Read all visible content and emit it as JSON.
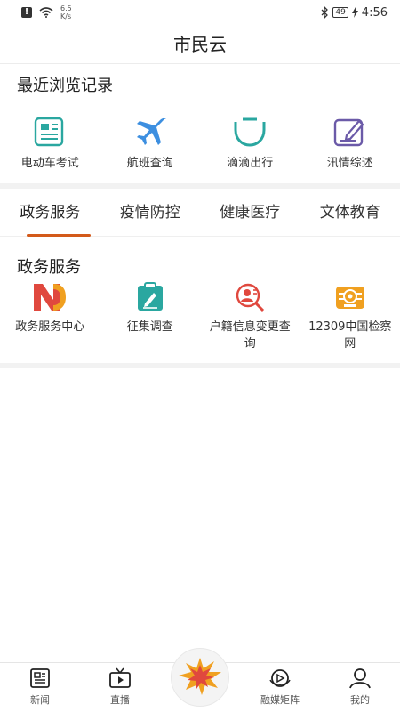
{
  "status_bar": {
    "net_speed_value": "6.5",
    "net_speed_unit": "K/s",
    "battery": "49",
    "time": "4:56"
  },
  "header": {
    "title": "市民云"
  },
  "recent": {
    "title": "最近浏览记录",
    "items": [
      {
        "label": "电动车考试",
        "icon": "document-list-icon"
      },
      {
        "label": "航班查询",
        "icon": "airplane-icon"
      },
      {
        "label": "滴滴出行",
        "icon": "didi-icon"
      },
      {
        "label": "汛情综述",
        "icon": "edit-note-icon"
      }
    ]
  },
  "tabs": [
    {
      "label": "政务服务"
    },
    {
      "label": "疫情防控"
    },
    {
      "label": "健康医疗"
    },
    {
      "label": "文体教育"
    }
  ],
  "gov_services": {
    "title": "政务服务",
    "items": [
      {
        "label": "政务服务中心",
        "icon": "n-logo-icon"
      },
      {
        "label": "征集调查",
        "icon": "clipboard-edit-icon"
      },
      {
        "label": "户籍信息变更查询",
        "icon": "person-search-icon"
      },
      {
        "label": "12309中国检察网",
        "icon": "procuratorate-badge-icon"
      }
    ]
  },
  "bottom_nav": [
    {
      "label": "新闻",
      "icon": "news-icon"
    },
    {
      "label": "直播",
      "icon": "tv-icon"
    },
    {
      "label": "融媒矩阵",
      "icon": "media-matrix-icon"
    },
    {
      "label": "我的",
      "icon": "profile-icon"
    }
  ],
  "colors": {
    "accent": "#d35a1a",
    "teal": "#2aa7a0",
    "blue": "#3d8fe0",
    "purple": "#6b5aa8",
    "red": "#e0483e",
    "orange": "#f0a020"
  }
}
